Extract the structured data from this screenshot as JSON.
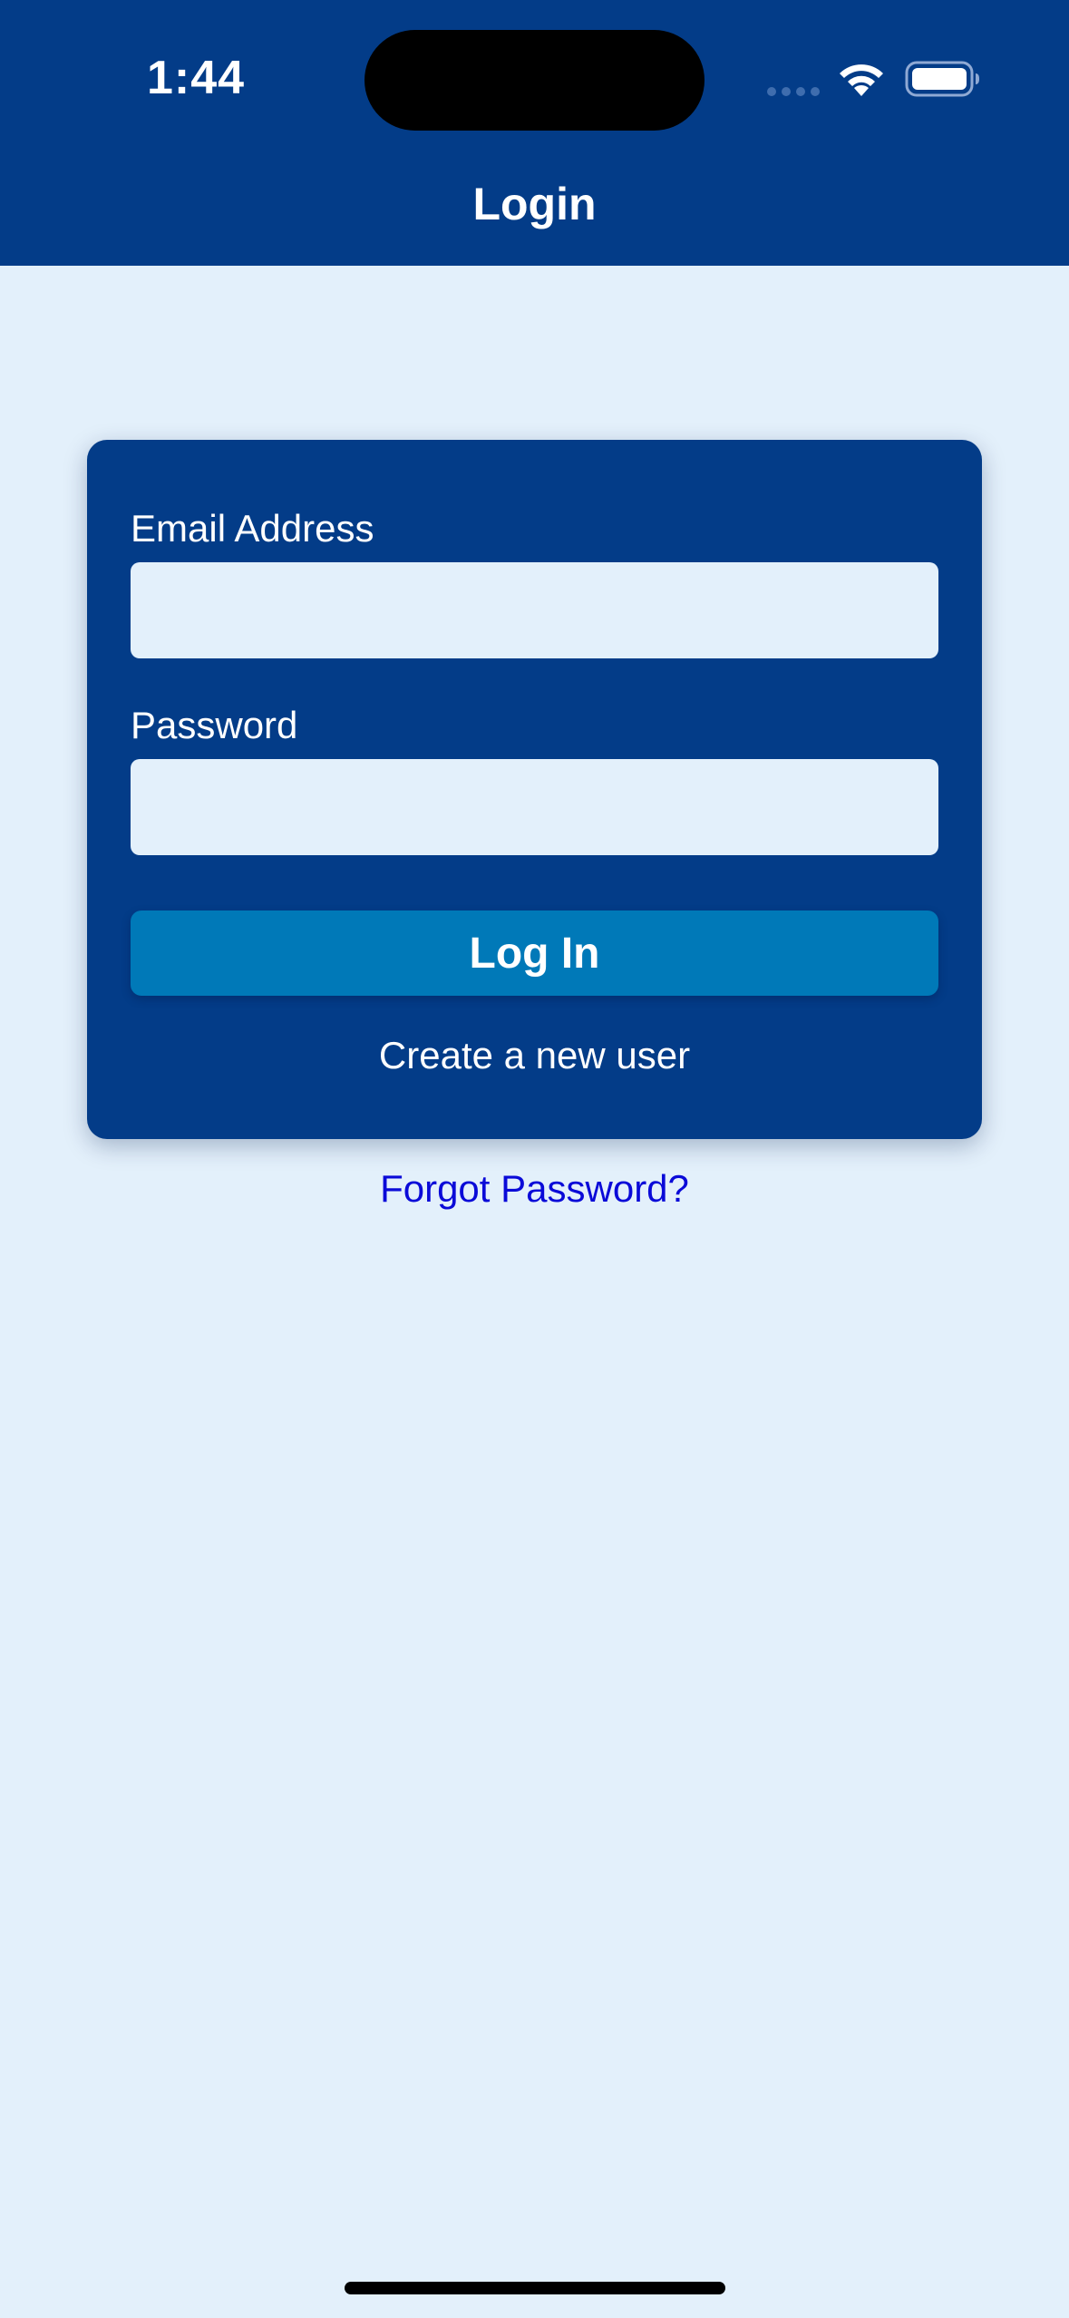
{
  "status_bar": {
    "time": "1:44"
  },
  "nav": {
    "title": "Login"
  },
  "form": {
    "email_label": "Email Address",
    "email_value": "",
    "password_label": "Password",
    "password_value": "",
    "login_button_label": "Log In",
    "create_user_label": "Create a new user"
  },
  "forgot_password_label": "Forgot Password?",
  "colors": {
    "header_bg": "#033C88",
    "card_bg": "#033C88",
    "page_bg": "#E3F0FB",
    "button_bg": "#0079B8",
    "link": "#0A0AD8"
  },
  "icons": [
    "signal-dots-icon",
    "wifi-icon",
    "battery-icon"
  ]
}
